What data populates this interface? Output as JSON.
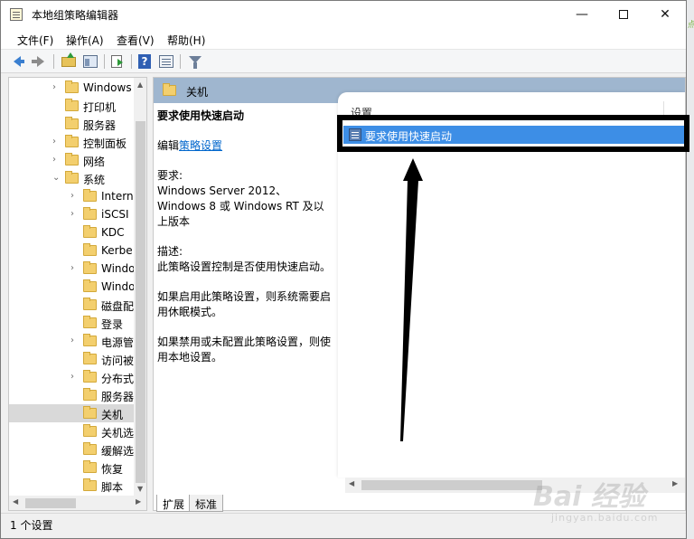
{
  "window": {
    "title": "本地组策略编辑器",
    "minimize_glyph": "—",
    "close_glyph": "✕"
  },
  "menu": {
    "items": [
      "文件(F)",
      "操作(A)",
      "查看(V)",
      "帮助(H)"
    ]
  },
  "tree": {
    "items": [
      {
        "label": "Windows",
        "caret": "›"
      },
      {
        "label": "打印机",
        "caret": ""
      },
      {
        "label": "服务器",
        "caret": ""
      },
      {
        "label": "控制面板",
        "caret": "›"
      },
      {
        "label": "网络",
        "caret": "›"
      },
      {
        "label": "系统",
        "caret": "⌄"
      },
      {
        "label": "Intern",
        "caret": "›"
      },
      {
        "label": "iSCSI",
        "caret": "›"
      },
      {
        "label": "KDC",
        "caret": ""
      },
      {
        "label": "Kerbe",
        "caret": ""
      },
      {
        "label": "Windo",
        "caret": "›"
      },
      {
        "label": "Windo",
        "caret": ""
      },
      {
        "label": "磁盘配",
        "caret": ""
      },
      {
        "label": "登录",
        "caret": ""
      },
      {
        "label": "电源管",
        "caret": "›"
      },
      {
        "label": "访问被",
        "caret": ""
      },
      {
        "label": "分布式",
        "caret": "›"
      },
      {
        "label": "服务器",
        "caret": ""
      },
      {
        "label": "关机",
        "caret": "",
        "selected": true
      },
      {
        "label": "关机选",
        "caret": ""
      },
      {
        "label": "缓解选",
        "caret": ""
      },
      {
        "label": "恢复",
        "caret": ""
      },
      {
        "label": "脚本",
        "caret": ""
      }
    ]
  },
  "content": {
    "header": "关机",
    "policy_title": "要求使用快速启动",
    "edit_prefix": "编辑",
    "edit_link": "策略设置",
    "requirements_label": "要求:",
    "requirements_text": "Windows Server 2012、Windows 8 或 Windows RT 及以上版本",
    "description_label": "描述:",
    "description_text": "此策略设置控制是否使用快速启动。",
    "enabled_text": "如果启用此策略设置，则系统需要启用休眠模式。",
    "disabled_text": "如果禁用或未配置此策略设置，则使用本地设置。",
    "column_header": "设置",
    "list_items": [
      "要求使用快速启动"
    ]
  },
  "tabs": [
    "扩展",
    "标准"
  ],
  "status": {
    "text": "1 个设置"
  },
  "watermark": {
    "brand": "Bai 经验",
    "sub": "jingyan.baidu.com"
  },
  "colors": {
    "selection": "#3d8ee6",
    "path_header": "#9fb6cf",
    "annotation": "#000000"
  }
}
